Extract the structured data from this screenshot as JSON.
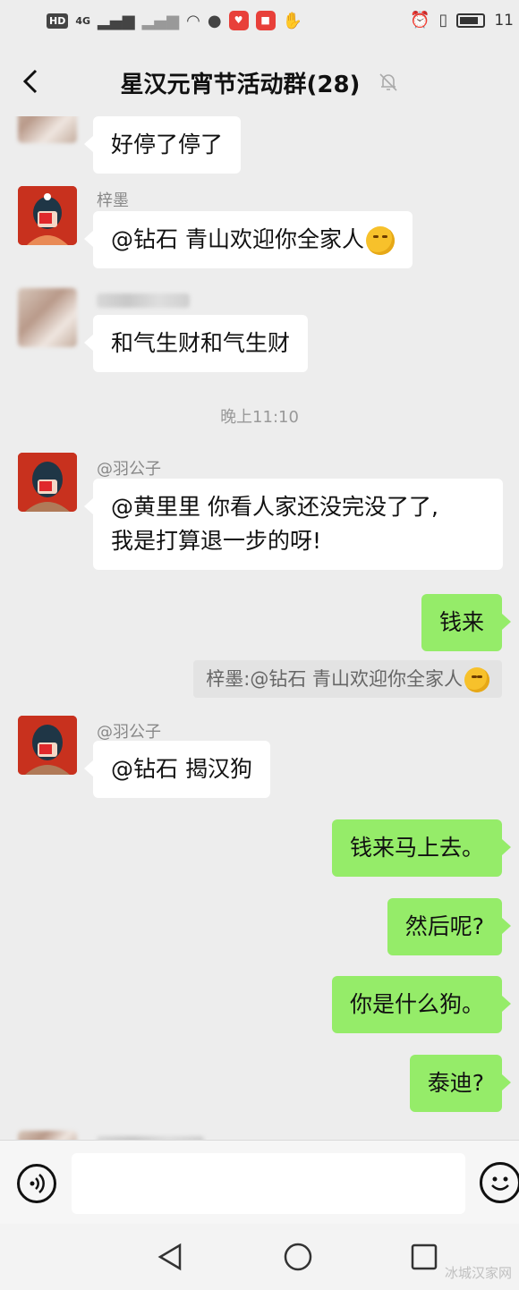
{
  "status_bar": {
    "signal_chip": "HD",
    "network": "4G",
    "time": "11"
  },
  "header": {
    "title": "星汉元宵节活动群(28)",
    "back_icon": "chevron-left-icon",
    "mute_icon": "bell-off-icon"
  },
  "messages": [
    {
      "type": "incoming",
      "sender": "",
      "text": "好停了停了"
    },
    {
      "type": "incoming",
      "sender": "梓墨",
      "text": "@钻石  青山欢迎你全家人"
    },
    {
      "type": "incoming",
      "sender": "",
      "text": "和气生财和气生财"
    },
    {
      "type": "time",
      "text": "晚上11:10"
    },
    {
      "type": "incoming",
      "sender": "@羽公子",
      "text_line1": "@黄里里  你看人家还没完没了了,",
      "text_line2": "我是打算退一步的呀!"
    },
    {
      "type": "outgoing",
      "text": "钱来"
    },
    {
      "type": "quote",
      "text": "梓墨:@钻石 青山欢迎你全家人"
    },
    {
      "type": "incoming",
      "sender": "@羽公子",
      "text": "@钻石  揭汉狗"
    },
    {
      "type": "outgoing",
      "text": "钱来马上去。"
    },
    {
      "type": "outgoing",
      "text": "然后呢?"
    },
    {
      "type": "outgoing",
      "text": "你是什么狗。"
    },
    {
      "type": "outgoing",
      "text": "泰迪?"
    }
  ],
  "input_bar": {
    "placeholder": "",
    "voice_icon": "voice-icon",
    "emoji_icon": "emoji-icon"
  },
  "nav": {
    "back_icon": "triangle-back-icon",
    "home_icon": "circle-home-icon",
    "recents_icon": "square-recents-icon"
  },
  "watermark": "冰城汉家网",
  "colors": {
    "background": "#ededed",
    "outgoing_bubble": "#95ec69",
    "incoming_bubble": "#ffffff"
  }
}
